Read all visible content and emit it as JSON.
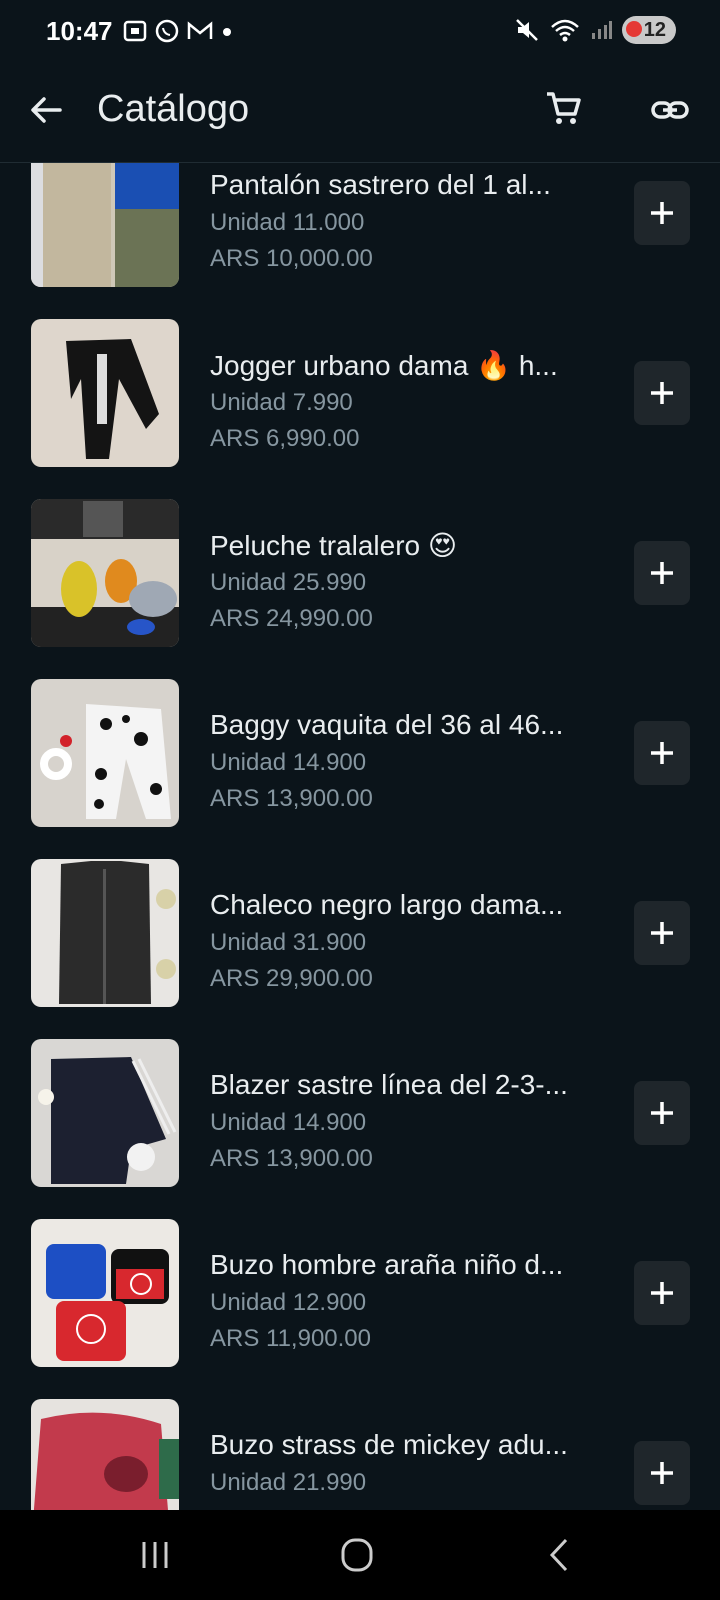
{
  "status": {
    "time": "10:47",
    "battery": "12"
  },
  "header": {
    "title": "Catálogo"
  },
  "colors": {
    "background": "#0b141a",
    "button": "#1f262b",
    "text": "#e9edef",
    "subtext": "#8696a0"
  },
  "items": [
    {
      "name": "Pantalón sastrero del 1 al...",
      "unit": "Unidad 11.000",
      "price": "ARS 10,000.00"
    },
    {
      "name": "Jogger urbano dama 🔥 h...",
      "unit": "Unidad 7.990",
      "price": "ARS 6,990.00"
    },
    {
      "name": "Peluche tralalero 😍",
      "unit": "Unidad 25.990",
      "price": "ARS 24,990.00"
    },
    {
      "name": "Baggy vaquita del 36 al 46...",
      "unit": "Unidad 14.900",
      "price": "ARS 13,900.00"
    },
    {
      "name": "Chaleco negro largo dama...",
      "unit": "Unidad 31.900",
      "price": "ARS 29,900.00"
    },
    {
      "name": "Blazer sastre línea del 2-3-...",
      "unit": "Unidad 14.900",
      "price": "ARS 13,900.00"
    },
    {
      "name": "Buzo hombre araña niño d...",
      "unit": "Unidad 12.900",
      "price": "ARS 11,900.00"
    },
    {
      "name": "Buzo strass de mickey adu...",
      "unit": "Unidad 21.990",
      "price": ""
    }
  ],
  "icons": [
    "back-arrow-icon",
    "cart-icon",
    "link-icon",
    "plus-icon",
    "recents-icon",
    "home-icon",
    "back-icon"
  ]
}
